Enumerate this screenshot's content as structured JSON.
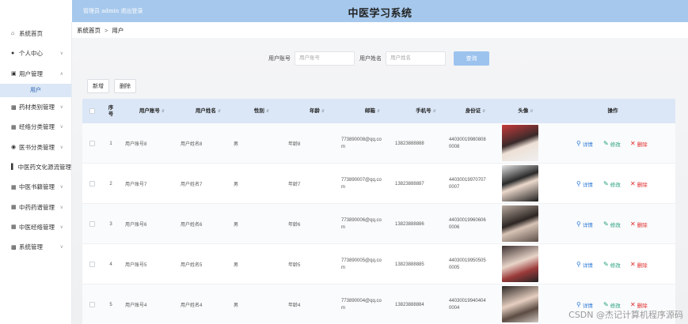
{
  "header": {
    "admin_text": "管理员 admin  退出登录",
    "title": "中医学习系统",
    "bg_color": "#a6c8ec"
  },
  "breadcrumb": {
    "home": "系统首页",
    "separator": ">",
    "current": "用户"
  },
  "sidebar": {
    "items": [
      {
        "label": "系统首页",
        "icon": "home-icon",
        "chevron": false
      },
      {
        "label": "个人中心",
        "icon": "person-icon",
        "chevron": true
      },
      {
        "label": "用户管理",
        "icon": "checkbox-icon",
        "chevron": true
      },
      {
        "label": "药材类别管理",
        "icon": "clipboard-icon",
        "chevron": true
      },
      {
        "label": "经络分类管理",
        "icon": "grid-icon",
        "chevron": true
      },
      {
        "label": "医书分类管理",
        "icon": "location-icon",
        "chevron": true
      },
      {
        "label": "中医药文化源流管理",
        "icon": "bar-chart-icon",
        "chevron": false
      },
      {
        "label": "中医书籍管理",
        "icon": "calendar-icon",
        "chevron": true
      },
      {
        "label": "中药药谱管理",
        "icon": "grid-icon",
        "chevron": true
      },
      {
        "label": "中医经络管理",
        "icon": "grid-icon",
        "chevron": true
      },
      {
        "label": "系统管理",
        "icon": "clipboard-icon",
        "chevron": true
      }
    ],
    "sub_item": "用户"
  },
  "search": {
    "account_label": "用户账号",
    "account_placeholder": "用户账号",
    "name_label": "用户姓名",
    "name_placeholder": "用户姓名",
    "button": "查询"
  },
  "actions": {
    "add": "新增",
    "delete": "删除"
  },
  "table": {
    "headers": [
      "序号",
      "用户账号",
      "用户姓名",
      "性别",
      "年龄",
      "邮箱",
      "手机号",
      "身份证",
      "头像",
      "操作"
    ],
    "rows": [
      {
        "index": "1",
        "account": "用户账号8",
        "name": "用户姓名8",
        "gender": "男",
        "age": "年龄8",
        "email": "773890008@qq.com",
        "phone": "13823888888",
        "idcard": "440300199808080008"
      },
      {
        "index": "2",
        "account": "用户账号7",
        "name": "用户姓名7",
        "gender": "男",
        "age": "年龄7",
        "email": "773890007@qq.com",
        "phone": "13823888887",
        "idcard": "440300199707070007"
      },
      {
        "index": "3",
        "account": "用户账号6",
        "name": "用户姓名6",
        "gender": "男",
        "age": "年龄6",
        "email": "773890006@qq.com",
        "phone": "13823888886",
        "idcard": "440300199606060006"
      },
      {
        "index": "4",
        "account": "用户账号5",
        "name": "用户姓名5",
        "gender": "男",
        "age": "年龄5",
        "email": "773890005@qq.com",
        "phone": "13823888885",
        "idcard": "440300199505050005"
      },
      {
        "index": "5",
        "account": "用户账号4",
        "name": "用户姓名4",
        "gender": "男",
        "age": "年龄4",
        "email": "773890004@qq.com",
        "phone": "13823888884",
        "idcard": "440300199404040004"
      }
    ],
    "ops": {
      "detail": "详情",
      "edit": "修改",
      "delete": "删除"
    }
  },
  "colors": {
    "accent": "#9cc3ee",
    "detail": "#2d7ad6",
    "edit": "#1f9c7a",
    "delete": "#e02a2a"
  },
  "watermark": "CSDN @杰记计算机程序源码"
}
